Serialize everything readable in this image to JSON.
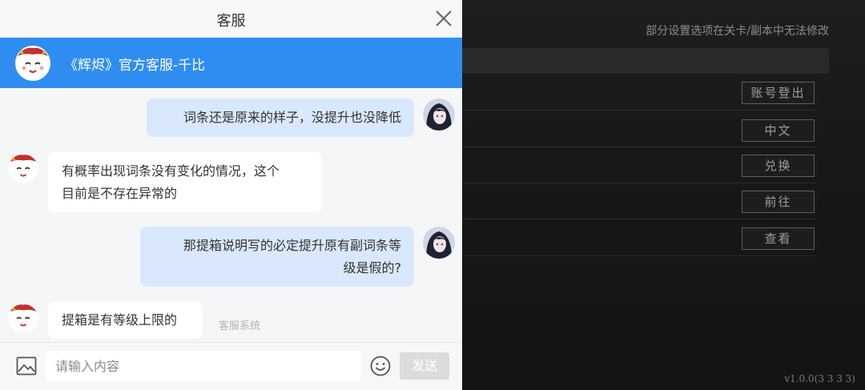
{
  "window": {
    "title": "客服"
  },
  "banner": {
    "name": "《辉烬》官方客服-千比"
  },
  "messages": [
    {
      "from": "user",
      "lines": [
        "词条还是原来的样子，没提升也没降低"
      ]
    },
    {
      "from": "agent",
      "lines": [
        "有概率出现词条没有变化的情况，这个",
        "目前是不存在异常的"
      ]
    },
    {
      "from": "user",
      "lines": [
        "那提箱说明写的必定提升原有副词条等",
        "级是假的?"
      ]
    },
    {
      "from": "agent",
      "lines": [
        "提箱是有等级上限的"
      ],
      "tag": "客服系统"
    }
  ],
  "input": {
    "placeholder": "请输入内容",
    "send_label": "发送"
  },
  "background": {
    "note": "部分设置选项在关卡/副本中无法修改",
    "buttons": [
      "账号登出",
      "中文",
      "兑换",
      "前往",
      "查看"
    ],
    "version": "v1.0.0(3 3 3 3)"
  },
  "colors": {
    "accent": "#2f8df2",
    "user_bubble": "#d9e8fc",
    "agent_bubble": "#ffffff"
  },
  "icons": {
    "close": "close-icon",
    "image": "image-icon",
    "emoji": "emoji-icon"
  }
}
